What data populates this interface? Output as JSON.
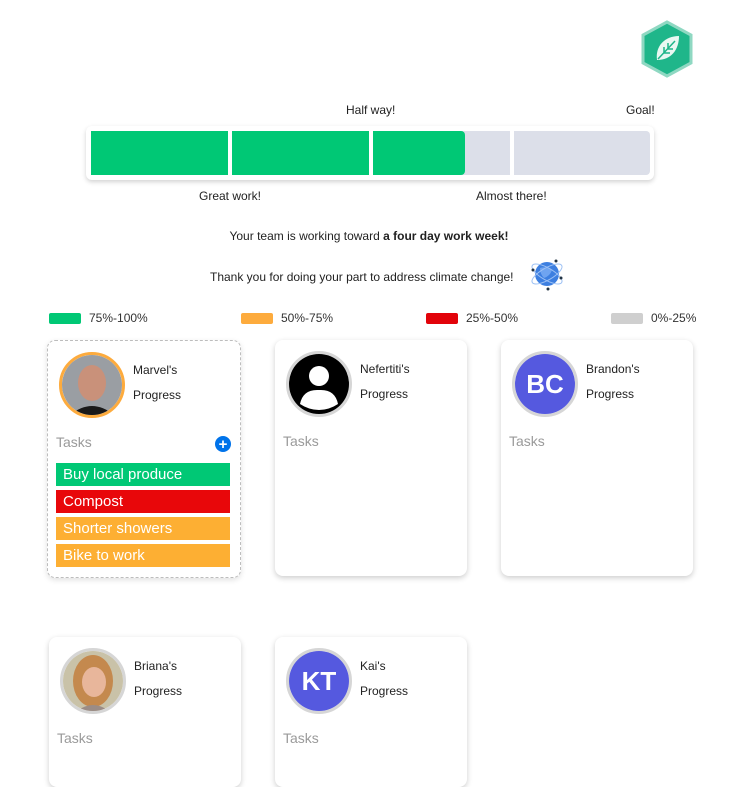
{
  "badge": {
    "icon": "leaf-icon",
    "color": "#1fb68a"
  },
  "progress": {
    "percent_complete": 66,
    "segments": 4,
    "labels": {
      "half_way": "Half way!",
      "goal": "Goal!",
      "great_work": "Great work!",
      "almost_there": "Almost there!"
    },
    "fill_color": "#00c875",
    "empty_color": "#dcdfe9"
  },
  "messages": {
    "team_prefix": "Your team is working toward ",
    "team_goal": "a four day work week!",
    "thanks": "Thank you for doing your part to address climate change!",
    "thanks_icon": "globe-icon"
  },
  "legend": [
    {
      "label": "75%-100%",
      "color": "#00c875"
    },
    {
      "label": "50%-75%",
      "color": "#fdab3d"
    },
    {
      "label": "25%-50%",
      "color": "#e2030a"
    },
    {
      "label": "0%-25%",
      "color": "#cfcfcf"
    }
  ],
  "members": [
    {
      "name": "Marvel's",
      "progress_label": "Progress",
      "avatar": "photo",
      "initials": "",
      "tasks_label": "Tasks",
      "selected": true,
      "tasks": [
        {
          "label": "Buy local produce",
          "color": "#00c875"
        },
        {
          "label": "Compost",
          "color": "#e8070a"
        },
        {
          "label": "Shorter showers",
          "color": "#fdaf33"
        },
        {
          "label": "Bike to work",
          "color": "#fdaf33"
        }
      ]
    },
    {
      "name": "Nefertiti's",
      "progress_label": "Progress",
      "avatar": "default-user",
      "initials": "",
      "tasks_label": "Tasks",
      "tasks": []
    },
    {
      "name": "Brandon's",
      "progress_label": "Progress",
      "avatar": "initials",
      "initials": "BC",
      "tasks_label": "Tasks",
      "tasks": []
    },
    {
      "name": "Briana's",
      "progress_label": "Progress",
      "avatar": "photo",
      "initials": "",
      "tasks_label": "Tasks",
      "tasks": []
    },
    {
      "name": "Kai's",
      "progress_label": "Progress",
      "avatar": "initials",
      "initials": "KT",
      "tasks_label": "Tasks",
      "tasks": []
    }
  ]
}
